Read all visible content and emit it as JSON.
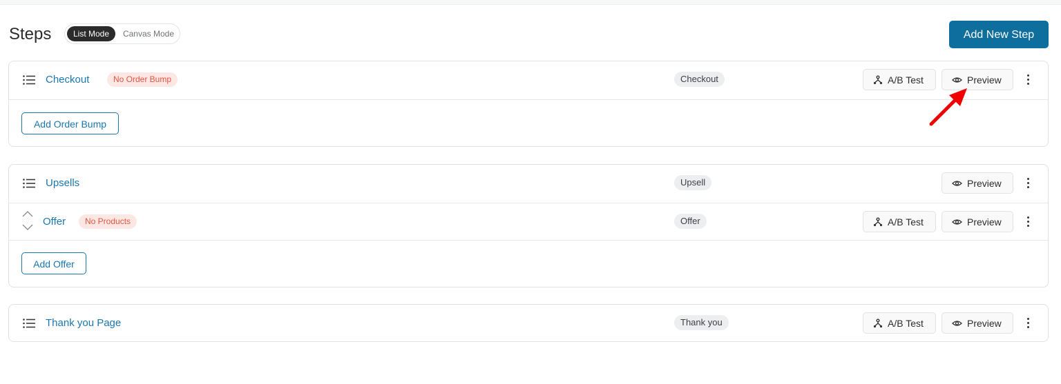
{
  "page": {
    "title": "Steps"
  },
  "mode_toggle": {
    "list": "List Mode",
    "canvas": "Canvas Mode",
    "active": "List Mode"
  },
  "add_new_step_label": "Add New Step",
  "buttons": {
    "ab_test": "A/B Test",
    "preview": "Preview"
  },
  "cards": {
    "checkout": {
      "title": "Checkout",
      "badge": "No Order Bump",
      "type": "Checkout",
      "action": "Add Order Bump"
    },
    "upsells": {
      "title": "Upsells",
      "type": "Upsell",
      "offer": {
        "title": "Offer",
        "badge": "No Products",
        "type": "Offer"
      },
      "action": "Add Offer"
    },
    "thankyou": {
      "title": "Thank you Page",
      "type": "Thank you"
    }
  },
  "colors": {
    "accent": "#0e6e9e",
    "link": "#1a77ae",
    "warning_bg": "#fde7e4",
    "warning_text": "#e5533f",
    "annotation_arrow": "#f00000"
  },
  "icons": [
    "drag-handle-icon",
    "ab-test-icon",
    "eye-icon",
    "kebab-menu-icon",
    "chevron-up-icon",
    "chevron-down-icon"
  ]
}
